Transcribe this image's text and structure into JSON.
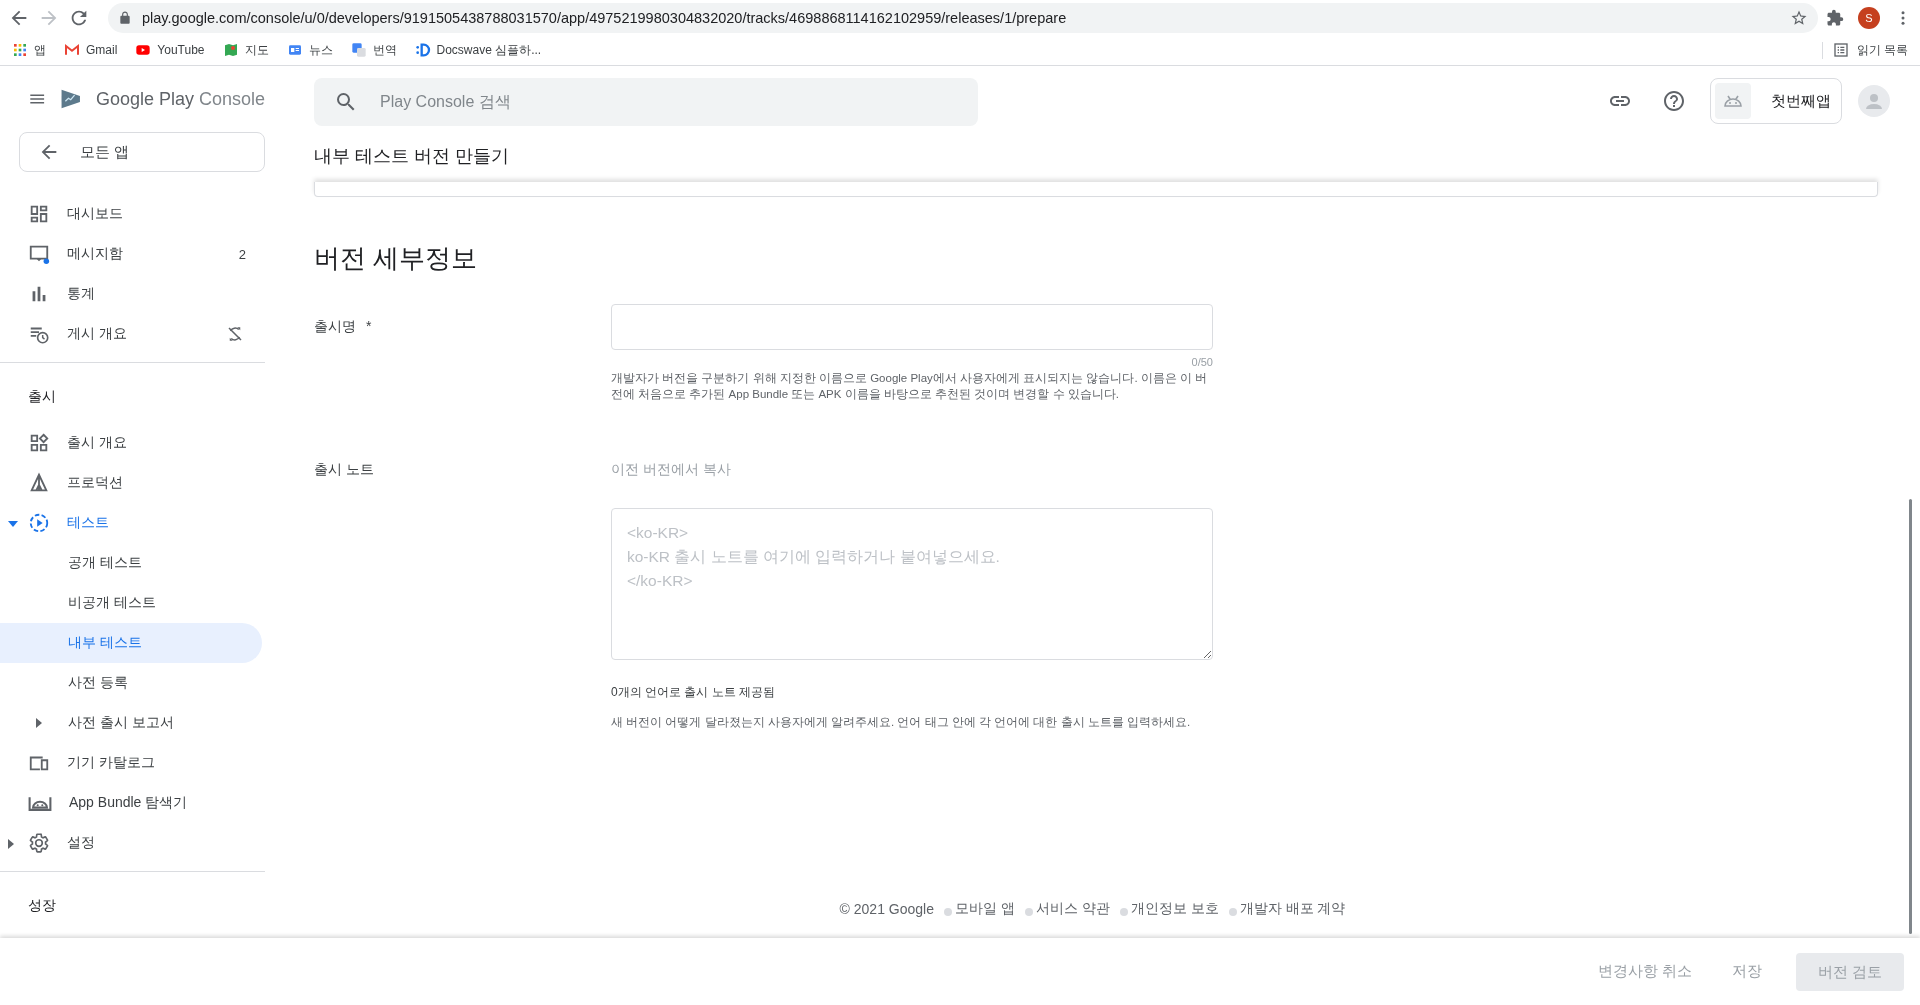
{
  "browser": {
    "url": "play.google.com/console/u/0/developers/9191505438788031570/app/4975219980304832020/tracks/4698868114162102959/releases/1/prepare",
    "profile_initial": "S",
    "bookmarks": [
      {
        "label": "앱"
      },
      {
        "label": "Gmail"
      },
      {
        "label": "YouTube"
      },
      {
        "label": "지도"
      },
      {
        "label": "뉴스"
      },
      {
        "label": "번역"
      },
      {
        "label": "Docswave 심플하..."
      }
    ],
    "reading_list": "읽기 목록"
  },
  "sidebar": {
    "brand_name": "Google Play",
    "brand_product": "Console",
    "back_button": "모든 앱",
    "groups": [
      {
        "items": [
          {
            "label": "대시보드",
            "selected": false
          },
          {
            "label": "메시지함",
            "badge": "2",
            "selected": false
          },
          {
            "label": "통계",
            "selected": false
          },
          {
            "label": "게시 개요",
            "selected": false
          }
        ]
      },
      {
        "title": "출시",
        "items": [
          {
            "label": "출시 개요",
            "selected": false
          },
          {
            "label": "프로덕션",
            "selected": false
          },
          {
            "label": "테스트",
            "selected": false,
            "expanded": true,
            "children": [
              {
                "label": "공개 테스트",
                "selected": false
              },
              {
                "label": "비공개 테스트",
                "selected": false
              },
              {
                "label": "내부 테스트",
                "selected": true
              },
              {
                "label": "사전 등록",
                "selected": false
              },
              {
                "label": "사전 출시 보고서",
                "selected": false,
                "expanded": false
              }
            ]
          },
          {
            "label": "기기 카탈로그",
            "selected": false
          },
          {
            "label": "App Bundle 탐색기",
            "selected": false
          },
          {
            "label": "설정",
            "selected": false,
            "expanded": false
          }
        ]
      },
      {
        "title": "성장"
      }
    ]
  },
  "header": {
    "search": {
      "placeholder": "Play Console 검색"
    },
    "app_name": "첫번째앱",
    "page_title": "내부 테스트 버전 만들기"
  },
  "form": {
    "section_title": "버전 세부정보",
    "release_name": {
      "label": "출시명",
      "required_mark": "*",
      "counter": "0/50",
      "help": "개발자가 버전을 구분하기 위해 지정한 이름으로 Google Play에서 사용자에게 표시되지는 않습니다. 이름은 이 버전에 처음으로 추가된 App Bundle 또는 APK 이름을 바탕으로 추천된 것이며 변경할 수 있습니다."
    },
    "release_notes": {
      "label": "출시 노트",
      "copy_link": {
        "label": "이전 버전에서 복사",
        "disabled": true
      },
      "placeholder": "<ko-KR>\nko-KR 출시 노트를 여기에 입력하거나 붙여넣으세요.\n</ko-KR>",
      "language_count": "0개의 언어로 출시 노트 제공됨",
      "help": "새 버전이 어떻게 달라졌는지 사용자에게 알려주세요. 언어 태그 안에 각 언어에 대한 출시 노트를 입력하세요."
    }
  },
  "footer": {
    "copyright": "© 2021 Google",
    "links": [
      "모바일 앱",
      "서비스 약관",
      "개인정보 보호",
      "개발자 배포 계약"
    ]
  },
  "actions": [
    {
      "label": "변경사항 취소",
      "kind": "text",
      "disabled": true
    },
    {
      "label": "저장",
      "kind": "text",
      "disabled": true
    },
    {
      "label": "버전 검토",
      "kind": "filled",
      "disabled": true
    }
  ]
}
